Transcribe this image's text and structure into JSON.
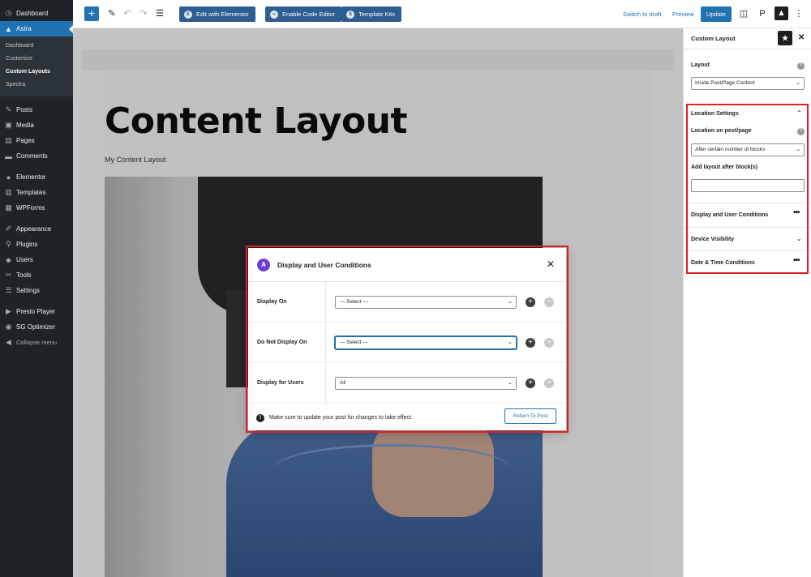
{
  "sidebar": {
    "top": [
      {
        "label": "Dashboard",
        "icon": "dashboard-icon"
      },
      {
        "label": "Astra",
        "icon": "astra-icon"
      }
    ],
    "astra_submenu": [
      "Dashboard",
      "Customize",
      "Custom Layouts",
      "Spectra"
    ],
    "group1": [
      {
        "label": "Posts",
        "icon": "pin-icon"
      },
      {
        "label": "Media",
        "icon": "media-icon"
      },
      {
        "label": "Pages",
        "icon": "pages-icon"
      },
      {
        "label": "Comments",
        "icon": "comments-icon"
      }
    ],
    "group2": [
      {
        "label": "Elementor",
        "icon": "elementor-icon"
      },
      {
        "label": "Templates",
        "icon": "templates-icon"
      },
      {
        "label": "WPForms",
        "icon": "wpforms-icon"
      }
    ],
    "group3": [
      {
        "label": "Appearance",
        "icon": "brush-icon"
      },
      {
        "label": "Plugins",
        "icon": "plug-icon"
      },
      {
        "label": "Users",
        "icon": "users-icon"
      },
      {
        "label": "Tools",
        "icon": "wrench-icon"
      },
      {
        "label": "Settings",
        "icon": "settings-icon"
      }
    ],
    "group4": [
      {
        "label": "Presto Player",
        "icon": "player-icon"
      },
      {
        "label": "SG Optimizer",
        "icon": "optimizer-icon"
      }
    ],
    "collapse_label": "Collapse menu"
  },
  "toolbar": {
    "edit_elementor": "Edit with Elementor",
    "enable_code_editor": "Enable Code Editor",
    "template_kits": "Template Kits",
    "switch_to_draft": "Switch to draft",
    "preview": "Preview",
    "update": "Update"
  },
  "editor": {
    "title": "Content Layout",
    "subtitle": "My Content Layout"
  },
  "panel": {
    "title": "Custom Layout",
    "layout_label": "Layout",
    "layout_value": "Inside Post/Page Content",
    "location_settings": "Location Settings",
    "location_on_post": "Location on post/page",
    "location_value": "After certain number of blocks",
    "add_after_label": "Add layout after block(s)",
    "add_after_value": "",
    "display_conditions": "Display and User Conditions",
    "device_visibility": "Device Visibility",
    "date_time": "Date & Time Conditions"
  },
  "modal": {
    "title": "Display and User Conditions",
    "rows": [
      {
        "label": "Display On",
        "value": "— Select —"
      },
      {
        "label": "Do Not Display On",
        "value": "— Select —"
      },
      {
        "label": "Display for Users",
        "value": "All"
      }
    ],
    "note": "Make sure to update your post for changes to take effect.",
    "return_button": "Return To Post"
  },
  "colors": {
    "wp_sidebar": "#1d2327",
    "wp_blue": "#2271b1",
    "highlight_red": "#e02020",
    "astra_purple": "#6b3fd6"
  }
}
